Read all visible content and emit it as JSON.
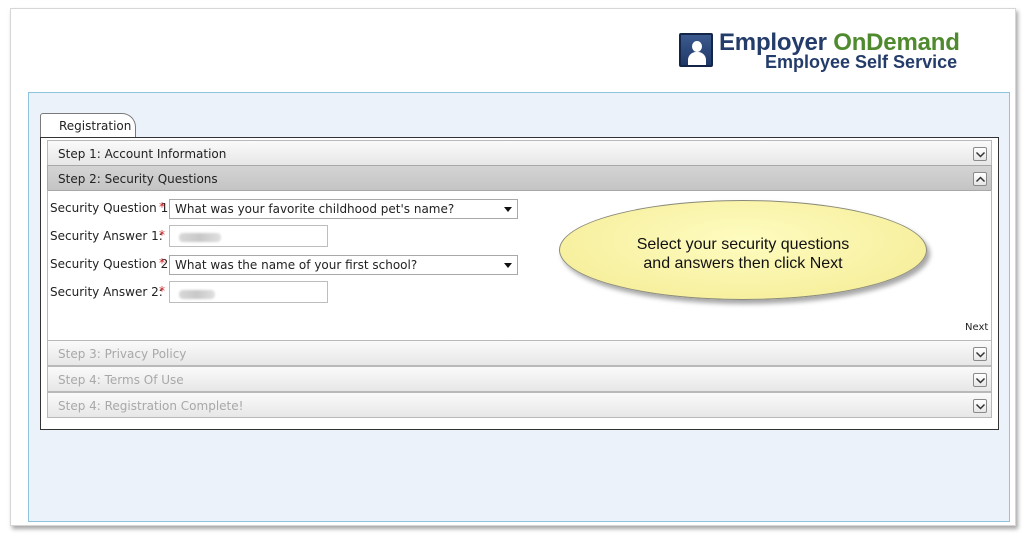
{
  "brand": {
    "name_part1": "Employer",
    "name_part2": "OnDemand",
    "subtitle": "Employee Self Service",
    "color_primary": "#243c6a",
    "color_accent": "#4f8a2e",
    "icon": "user-badge-icon"
  },
  "tab": {
    "label": "Registration"
  },
  "steps": [
    {
      "label": "Step 1: Account Information",
      "state": "collapsed",
      "icon": "chevron-down-icon"
    },
    {
      "label": "Step 2: Security Questions",
      "state": "expanded",
      "icon": "chevron-up-icon"
    },
    {
      "label": "Step 3: Privacy Policy",
      "state": "disabled",
      "icon": "chevron-down-icon"
    },
    {
      "label": "Step 4: Terms Of Use",
      "state": "disabled",
      "icon": "chevron-down-icon"
    },
    {
      "label": "Step 4: Registration Complete!",
      "state": "disabled",
      "icon": "chevron-down-icon"
    }
  ],
  "form": {
    "required_marker": "*",
    "question1_label": "Security Question 1:",
    "question1_value": "What was your favorite childhood pet's name?",
    "answer1_label": "Security Answer 1:",
    "answer1_value": "",
    "question2_label": "Security Question 2:",
    "question2_value": "What was the name of your first school?",
    "answer2_label": "Security Answer 2:",
    "answer2_value": "",
    "next_label": "Next"
  },
  "callout": {
    "line1": "Select your security questions",
    "line2": "and answers then click Next"
  }
}
